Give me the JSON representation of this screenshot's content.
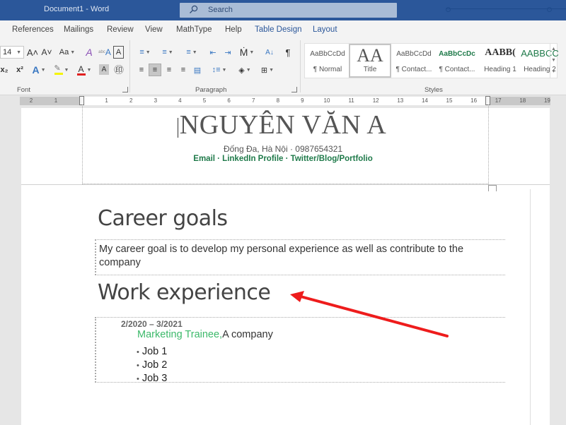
{
  "titlebar": {
    "doc_title": "Document1  -  Word",
    "search_placeholder": "Search"
  },
  "tabs": [
    {
      "label": "References"
    },
    {
      "label": "Mailings"
    },
    {
      "label": "Review"
    },
    {
      "label": "View"
    },
    {
      "label": "MathType"
    },
    {
      "label": "Help"
    },
    {
      "label": "Table Design"
    },
    {
      "label": "Layout"
    }
  ],
  "ribbon": {
    "font": {
      "size": "14",
      "group_label": "Font",
      "grow_icon": "A˄",
      "shrink_icon": "A˅",
      "change_case": "Aa",
      "subscript": "x₂",
      "superscript": "x²"
    },
    "paragraph": {
      "group_label": "Paragraph",
      "show_marks": "¶"
    },
    "styles": {
      "group_label": "Styles",
      "items": [
        {
          "preview": "AaBbCcDd",
          "name": "¶ Normal"
        },
        {
          "preview": "AA",
          "name": "Title"
        },
        {
          "preview": "AaBbCcDd",
          "name": "¶ Contact..."
        },
        {
          "preview": "AaBbCcDc",
          "name": "¶ Contact..."
        },
        {
          "preview": "AABB(",
          "name": "Heading 1"
        },
        {
          "preview": "AABBCC",
          "name": "Heading 2"
        }
      ]
    }
  },
  "ruler": {
    "left_ticks": [
      "2",
      "1"
    ],
    "right_ticks": [
      "1",
      "2",
      "3",
      "4",
      "5",
      "6",
      "7",
      "8",
      "9",
      "10",
      "11",
      "12",
      "13",
      "14",
      "15",
      "16",
      "17",
      "18",
      "19"
    ]
  },
  "document": {
    "name": "NGUYÊN VĂN A",
    "contact": "Đống Đa, Hà Nội · 0987654321",
    "links": "Email · LinkedIn Profile · Twitter/Blog/Portfolio",
    "career_heading": "Career goals",
    "career_text": "My career goal is to develop my personal experience as well as contribute to the company",
    "work_heading": "Work experience",
    "work": {
      "date": "2/2020 – 3/2021",
      "title": "Marketing Trainee,",
      "company": "A company",
      "jobs": [
        "Job 1",
        "Job 2",
        "Job 3"
      ]
    }
  },
  "annotation": {
    "arrow_color": "#ee1c1c"
  },
  "colors": {
    "titlebar": "#2b579a",
    "link_green": "#1f7a4a",
    "role_green": "#3cb96a"
  }
}
